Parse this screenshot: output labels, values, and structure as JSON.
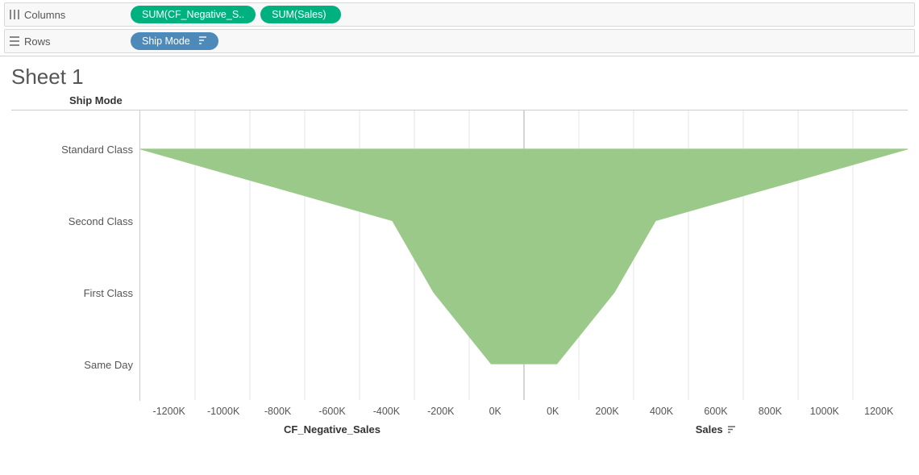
{
  "shelves": {
    "columns": {
      "label": "Columns",
      "pills": [
        {
          "text": "SUM(CF_Negative_S..",
          "color": "green"
        },
        {
          "text": "SUM(Sales)",
          "color": "green"
        }
      ]
    },
    "rows": {
      "label": "Rows",
      "pills": [
        {
          "text": "Ship Mode",
          "color": "blue",
          "sorted": true
        }
      ]
    }
  },
  "sheet": {
    "title": "Sheet 1",
    "header": "Ship Mode"
  },
  "chart_data": {
    "type": "area",
    "categories": [
      "Standard Class",
      "Second Class",
      "First Class",
      "Same Day"
    ],
    "series": [
      {
        "name": "CF_Negative_Sales",
        "values": [
          -1400000,
          -480000,
          -330000,
          -120000
        ]
      },
      {
        "name": "Sales",
        "values": [
          1400000,
          480000,
          330000,
          120000
        ]
      }
    ],
    "left_axis": {
      "label": "CF_Negative_Sales",
      "ticks": [
        "-1200K",
        "-1000K",
        "-800K",
        "-600K",
        "-400K",
        "-200K",
        "0K"
      ],
      "range": [
        -1400000,
        0
      ]
    },
    "right_axis": {
      "label": "Sales",
      "ticks": [
        "0K",
        "200K",
        "400K",
        "600K",
        "800K",
        "1000K",
        "1200K"
      ],
      "range": [
        0,
        1400000
      ],
      "sorted": true
    },
    "colors": {
      "fill": "#9bc989"
    }
  }
}
